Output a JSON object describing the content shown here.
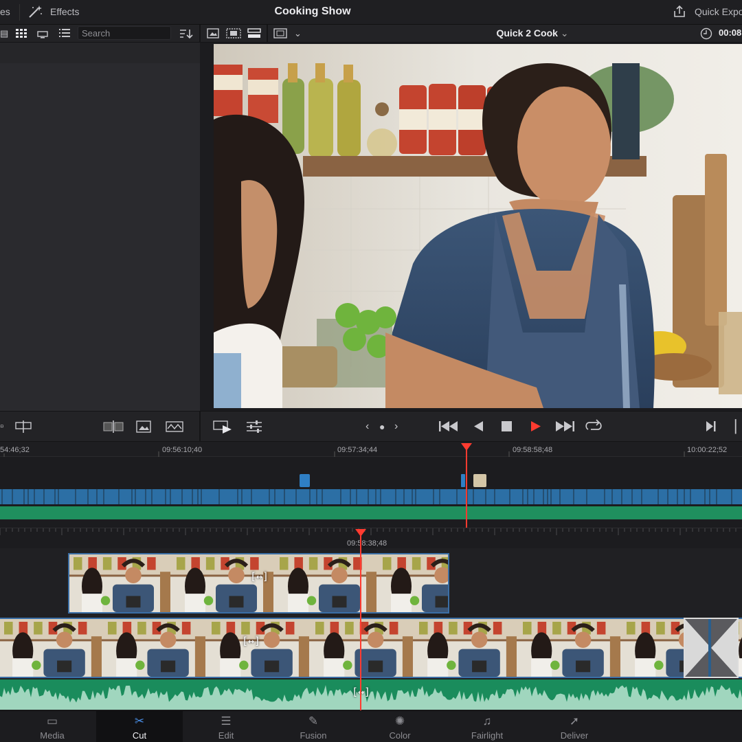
{
  "topbar": {
    "left_fragment": "es",
    "effects_label": "Effects",
    "title": "Cooking Show",
    "quick_export_label": "Quick Expor"
  },
  "toolbar": {
    "search_placeholder": "Search",
    "clip_name": "Quick 2 Cook",
    "timecode": "00:08"
  },
  "ruler_upper": {
    "ticks": [
      "54:46;32",
      "09:56:10;40",
      "09:57:34;44",
      "09:58:58;48",
      "10:00:22;52"
    ]
  },
  "ruler_lower": {
    "playhead_timecode": "09:58:38;48"
  },
  "bottom_nav": {
    "items": [
      {
        "label": "Media",
        "icon": "media-icon",
        "glyph": "▭"
      },
      {
        "label": "Cut",
        "icon": "cut-icon",
        "glyph": "✂"
      },
      {
        "label": "Edit",
        "icon": "edit-icon",
        "glyph": "☰"
      },
      {
        "label": "Fusion",
        "icon": "fusion-icon",
        "glyph": "✎"
      },
      {
        "label": "Color",
        "icon": "color-icon",
        "glyph": "✺"
      },
      {
        "label": "Fairlight",
        "icon": "fairlight-icon",
        "glyph": "♫"
      },
      {
        "label": "Deliver",
        "icon": "deliver-icon",
        "glyph": "➚"
      }
    ],
    "active": "Cut"
  },
  "colors": {
    "accent_play": "#ff3b30",
    "accent_active": "#4a8fe7",
    "clip_border": "#3b6fa6",
    "audio_green": "#1a8c5c"
  }
}
